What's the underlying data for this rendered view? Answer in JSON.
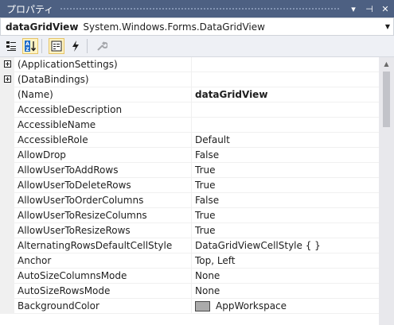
{
  "window": {
    "title": "プロパティ",
    "dropdown_icon": "▾",
    "pin_icon": "⊣",
    "close_icon": "✕"
  },
  "object_selector": {
    "name": "dataGridView",
    "type": "System.Windows.Forms.DataGridView"
  },
  "toolbar": {
    "buttons": [
      "categorized-icon",
      "alphabetical-icon",
      "properties-icon",
      "events-icon",
      "property-pages-icon"
    ]
  },
  "properties": [
    {
      "name": "(ApplicationSettings)",
      "value": "",
      "expandable": true
    },
    {
      "name": "(DataBindings)",
      "value": "",
      "expandable": true
    },
    {
      "name": "(Name)",
      "value": "dataGridView",
      "bold": true
    },
    {
      "name": "AccessibleDescription",
      "value": ""
    },
    {
      "name": "AccessibleName",
      "value": ""
    },
    {
      "name": "AccessibleRole",
      "value": "Default"
    },
    {
      "name": "AllowDrop",
      "value": "False"
    },
    {
      "name": "AllowUserToAddRows",
      "value": "True"
    },
    {
      "name": "AllowUserToDeleteRows",
      "value": "True"
    },
    {
      "name": "AllowUserToOrderColumns",
      "value": "False"
    },
    {
      "name": "AllowUserToResizeColumns",
      "value": "True"
    },
    {
      "name": "AllowUserToResizeRows",
      "value": "True"
    },
    {
      "name": "AlternatingRowsDefaultCellStyle",
      "value": "DataGridViewCellStyle { }"
    },
    {
      "name": "Anchor",
      "value": "Top, Left"
    },
    {
      "name": "AutoSizeColumnsMode",
      "value": "None"
    },
    {
      "name": "AutoSizeRowsMode",
      "value": "None"
    },
    {
      "name": "BackgroundColor",
      "value": "AppWorkspace",
      "color_swatch": "#ababab"
    }
  ]
}
